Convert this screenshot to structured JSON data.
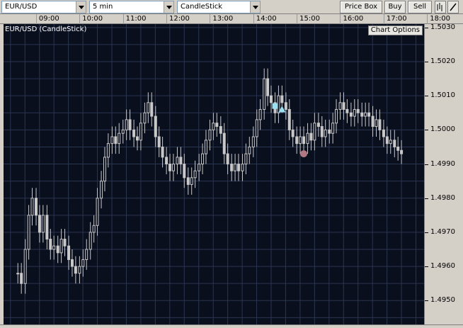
{
  "toolbar": {
    "symbol": "EUR/USD",
    "interval": "5 min",
    "chart_type": "CandleStick",
    "price_box_label": "Price Box",
    "buy_label": "Buy",
    "sell_label": "Sell"
  },
  "chart": {
    "title": "EUR/USD (CandleStick)",
    "options_label": "Chart Options"
  },
  "colors": {
    "background": "#0a0f1e",
    "grid": "#2a3550",
    "candle": "#c8c8c8",
    "marker_square": "#9be0f0",
    "marker_triangle": "#9be0f0",
    "marker_circle": "#b07880"
  },
  "chart_data": {
    "type": "candlestick",
    "x": [
      "09:00",
      "10:00",
      "11:00",
      "12:00",
      "13:00",
      "14:00",
      "15:00",
      "16:00",
      "17:00",
      "18:00"
    ],
    "y_ticks": [
      "1.5030",
      "1.5020",
      "1.5010",
      "1.5000",
      "1.4990",
      "1.4980",
      "1.4970",
      "1.4960",
      "1.4950"
    ],
    "ylim": [
      1.4943,
      1.5031
    ],
    "grid": true,
    "series": [
      {
        "points": [
          [
            8.5,
            1.4958
          ],
          [
            8.58,
            1.4955
          ],
          [
            8.67,
            1.4965
          ],
          [
            8.75,
            1.4975
          ],
          [
            8.83,
            1.498
          ],
          [
            8.92,
            1.4975
          ],
          [
            9.0,
            1.497
          ],
          [
            9.08,
            1.4975
          ],
          [
            9.17,
            1.4968
          ],
          [
            9.25,
            1.4965
          ],
          [
            9.33,
            1.4966
          ],
          [
            9.42,
            1.4964
          ],
          [
            9.5,
            1.4968
          ],
          [
            9.58,
            1.4966
          ],
          [
            9.67,
            1.4962
          ],
          [
            9.75,
            1.496
          ],
          [
            9.83,
            1.4958
          ],
          [
            9.92,
            1.496
          ],
          [
            10.0,
            1.4962
          ],
          [
            10.08,
            1.4965
          ],
          [
            10.17,
            1.497
          ],
          [
            10.25,
            1.4972
          ],
          [
            10.33,
            1.498
          ],
          [
            10.42,
            1.4985
          ],
          [
            10.5,
            1.4992
          ],
          [
            10.58,
            1.4996
          ],
          [
            10.67,
            1.4998
          ],
          [
            10.75,
            1.4996
          ],
          [
            10.83,
            1.4999
          ],
          [
            10.92,
            1.5
          ],
          [
            11.0,
            1.5003
          ],
          [
            11.08,
            1.5
          ],
          [
            11.17,
            1.4998
          ],
          [
            11.25,
            1.4997
          ],
          [
            11.33,
            1.5002
          ],
          [
            11.42,
            1.5005
          ],
          [
            11.5,
            1.5008
          ],
          [
            11.58,
            1.5004
          ],
          [
            11.67,
            1.4998
          ],
          [
            11.75,
            1.4995
          ],
          [
            11.83,
            1.4992
          ],
          [
            11.92,
            1.499
          ],
          [
            12.0,
            1.4988
          ],
          [
            12.08,
            1.499
          ],
          [
            12.17,
            1.4992
          ],
          [
            12.25,
            1.499
          ],
          [
            12.33,
            1.4986
          ],
          [
            12.42,
            1.4984
          ],
          [
            12.5,
            1.4986
          ],
          [
            12.58,
            1.4988
          ],
          [
            12.67,
            1.499
          ],
          [
            12.75,
            1.4993
          ],
          [
            12.83,
            1.4997
          ],
          [
            12.92,
            1.5
          ],
          [
            13.0,
            1.5002
          ],
          [
            13.08,
            1.5001
          ],
          [
            13.17,
            1.4999
          ],
          [
            13.25,
            1.4993
          ],
          [
            13.33,
            1.499
          ],
          [
            13.42,
            1.4988
          ],
          [
            13.5,
            1.499
          ],
          [
            13.58,
            1.4988
          ],
          [
            13.67,
            1.499
          ],
          [
            13.75,
            1.4993
          ],
          [
            13.83,
            1.4995
          ],
          [
            13.92,
            1.4998
          ],
          [
            14.0,
            1.5003
          ],
          [
            14.08,
            1.5006
          ],
          [
            14.17,
            1.5015
          ],
          [
            14.25,
            1.501
          ],
          [
            14.33,
            1.5008
          ],
          [
            14.42,
            1.5005
          ],
          [
            14.5,
            1.501
          ],
          [
            14.58,
            1.5008
          ],
          [
            14.67,
            1.5006
          ],
          [
            14.75,
            1.5
          ],
          [
            14.83,
            1.4998
          ],
          [
            14.92,
            1.4996
          ],
          [
            15.0,
            1.4998
          ],
          [
            15.08,
            1.4996
          ],
          [
            15.17,
            1.4999
          ],
          [
            15.25,
            1.4997
          ],
          [
            15.33,
            1.5002
          ],
          [
            15.42,
            1.5001
          ],
          [
            15.5,
            1.4998
          ],
          [
            15.58,
            1.5
          ],
          [
            15.67,
            1.4999
          ],
          [
            15.75,
            1.5002
          ],
          [
            15.83,
            1.5006
          ],
          [
            15.92,
            1.5008
          ],
          [
            16.0,
            1.5006
          ],
          [
            16.08,
            1.5005
          ],
          [
            16.17,
            1.5004
          ],
          [
            16.25,
            1.5006
          ],
          [
            16.33,
            1.5005
          ],
          [
            16.42,
            1.5004
          ],
          [
            16.5,
            1.5005
          ],
          [
            16.58,
            1.5004
          ],
          [
            16.67,
            1.5001
          ],
          [
            16.75,
            1.5003
          ],
          [
            16.83,
            1.5
          ],
          [
            16.92,
            1.4998
          ],
          [
            17.0,
            1.4996
          ],
          [
            17.08,
            1.4997
          ],
          [
            17.17,
            1.4995
          ],
          [
            17.25,
            1.4994
          ],
          [
            17.33,
            1.4993
          ]
        ]
      }
    ],
    "markers": [
      {
        "shape": "square",
        "time": 14.42,
        "price": 1.5007
      },
      {
        "shape": "triangle",
        "time": 14.58,
        "price": 1.5006
      },
      {
        "shape": "circle",
        "time": 15.08,
        "price": 1.4993
      }
    ]
  }
}
